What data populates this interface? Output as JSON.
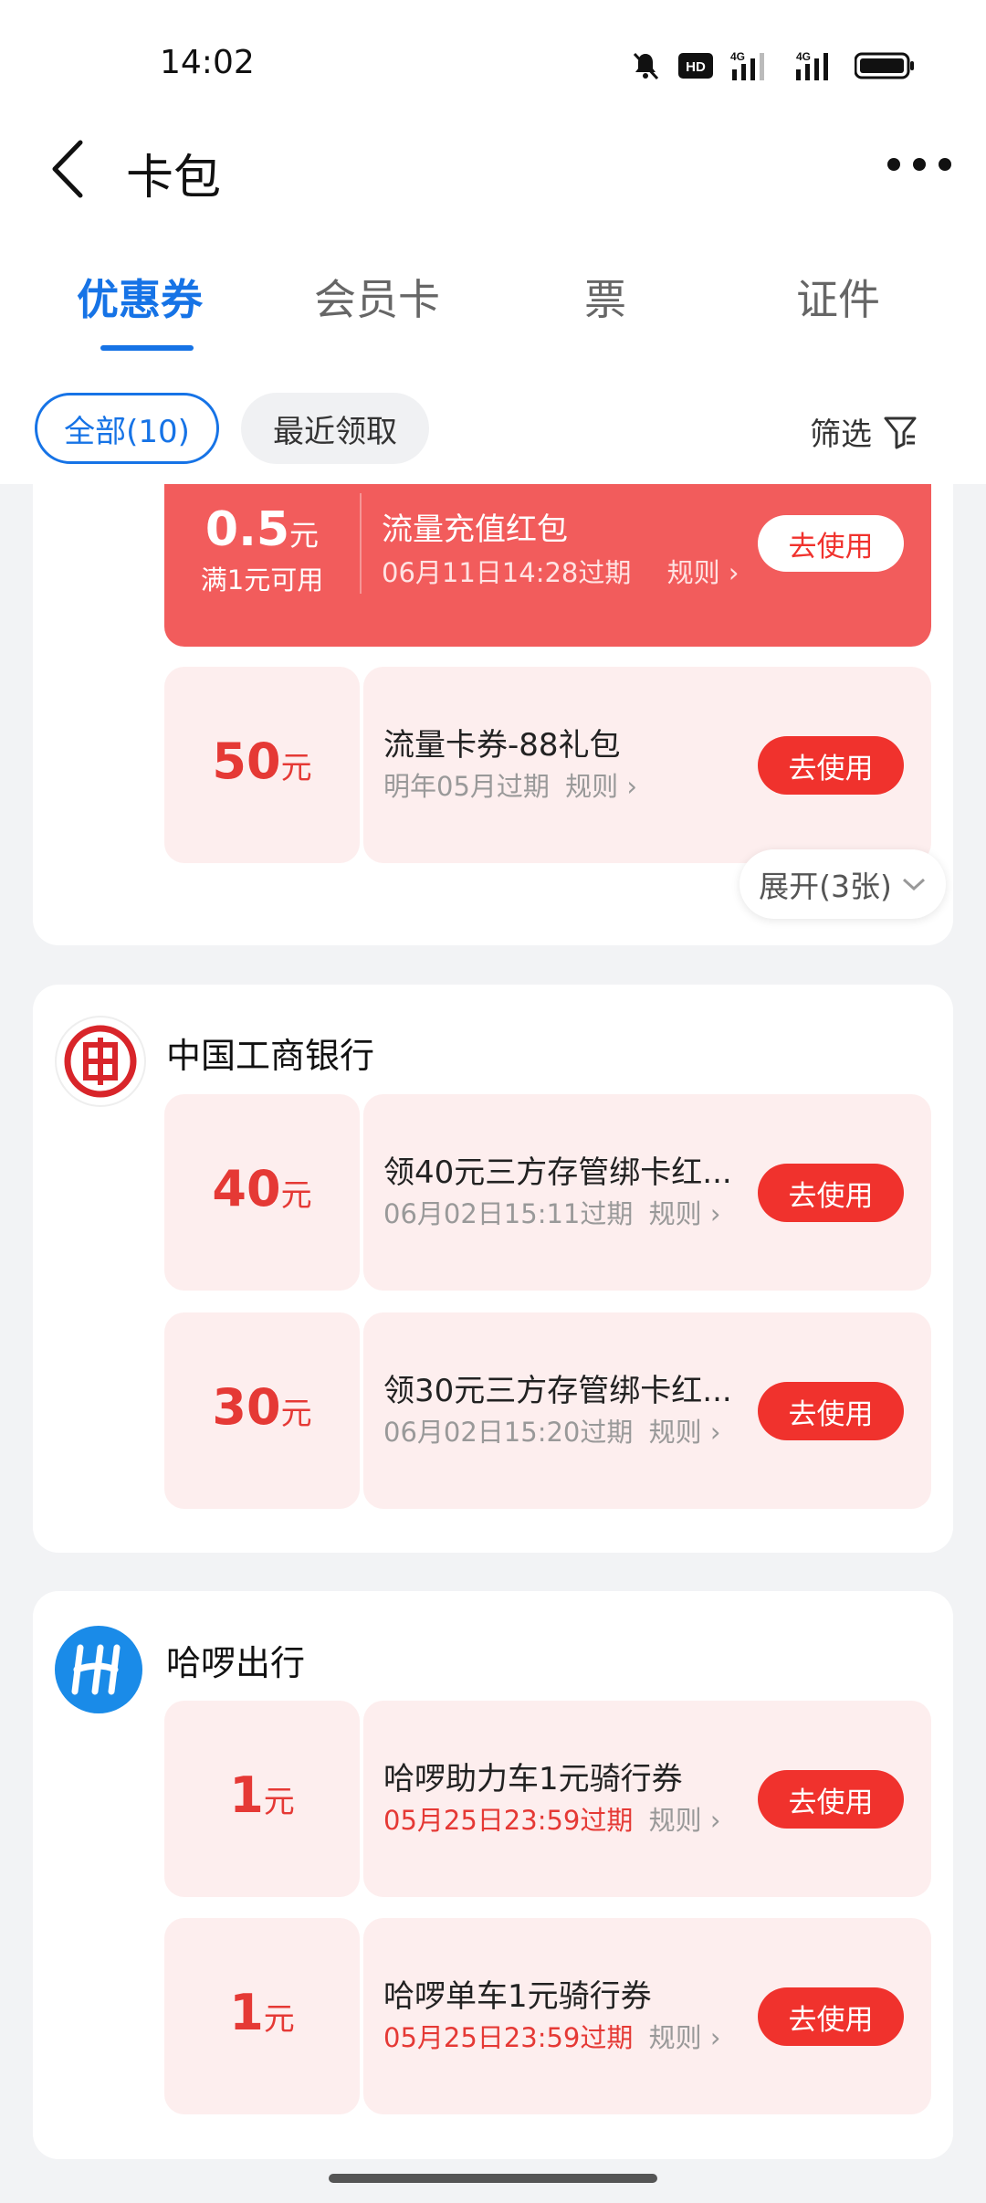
{
  "status": {
    "time": "14:02",
    "hd_label": "HD",
    "net1": "4G",
    "net2": "4G"
  },
  "header": {
    "title": "卡包"
  },
  "tabs": [
    "优惠券",
    "会员卡",
    "票",
    "证件"
  ],
  "filters": {
    "all": "全部(10)",
    "recent": "最近领取",
    "filter": "筛选"
  },
  "group1": {
    "red_coupon": {
      "amount": "0.5",
      "unit": "元",
      "condition": "满1元可用",
      "title": "流量充值红包",
      "expiry": "06月11日14:28过期",
      "rule": "规则",
      "button": "去使用"
    },
    "coupons": [
      {
        "amount": "50",
        "unit": "元",
        "title": "流量卡券-88礼包",
        "expiry": "明年05月过期",
        "rule": "规则",
        "button": "去使用"
      }
    ],
    "expand": "展开(3张)"
  },
  "group2": {
    "brand": "中国工商银行",
    "coupons": [
      {
        "amount": "40",
        "unit": "元",
        "title": "领40元三方存管绑卡红...",
        "expiry": "06月02日15:11过期",
        "rule": "规则",
        "button": "去使用"
      },
      {
        "amount": "30",
        "unit": "元",
        "title": "领30元三方存管绑卡红...",
        "expiry": "06月02日15:20过期",
        "rule": "规则",
        "button": "去使用"
      }
    ]
  },
  "group3": {
    "brand": "哈啰出行",
    "coupons": [
      {
        "amount": "1",
        "unit": "元",
        "title": "哈啰助力车1元骑行券",
        "expiry": "05月25日23:59过期",
        "rule": "规则",
        "button": "去使用"
      },
      {
        "amount": "1",
        "unit": "元",
        "title": "哈啰单车1元骑行券",
        "expiry": "05月25日23:59过期",
        "rule": "规则",
        "button": "去使用"
      }
    ]
  },
  "colors": {
    "accent": "#1673e6",
    "coupon_red": "#e53935",
    "button_red": "#f0322d",
    "red_coupon_bg": "#f25c5c",
    "coupon_bg": "#fdeeee"
  }
}
